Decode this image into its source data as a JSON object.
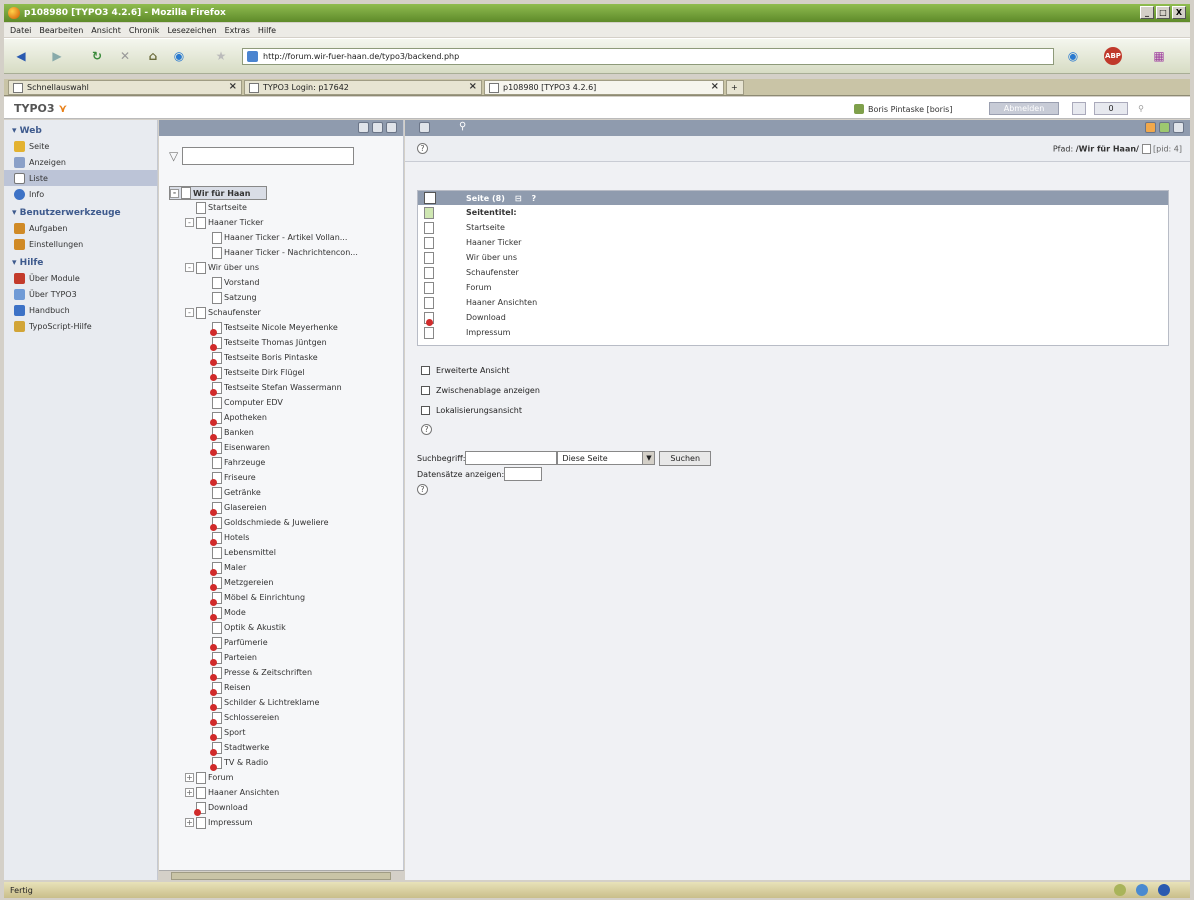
{
  "window": {
    "title": "p108980 [TYPO3 4.2.6] - Mozilla Firefox",
    "buttons": [
      "_",
      "□",
      "X"
    ]
  },
  "menubar": [
    "Datei",
    "Bearbeiten",
    "Ansicht",
    "Chronik",
    "Lesezeichen",
    "Extras",
    "Hilfe"
  ],
  "urlbar": {
    "url": "http://forum.wir-fuer-haan.de/typo3/backend.php"
  },
  "tabs": [
    {
      "label": "Schnellauswahl"
    },
    {
      "label": "TYPO3 Login: p17642"
    },
    {
      "label": "p108980 [TYPO3 4.2.6]"
    }
  ],
  "t3": {
    "logo": "TYPO3",
    "user": "Boris Pintaske [boris]",
    "logout": "Abmelden",
    "counter": "0"
  },
  "modules": {
    "groups": [
      {
        "label": "Web",
        "items": [
          "Seite",
          "Anzeigen",
          "Liste",
          "Info"
        ]
      },
      {
        "label": "Benutzerwerkzeuge",
        "items": [
          "Aufgaben",
          "Einstellungen"
        ]
      },
      {
        "label": "Hilfe",
        "items": [
          "Über Module",
          "Über TYPO3",
          "Handbuch",
          "TypoScript-Hilfe"
        ]
      }
    ],
    "icon_colors": {
      "Seite": "#e3b230",
      "Anzeigen": "#8aa0c8",
      "Liste": "#ffffff",
      "Info": "#3d72c6",
      "Aufgaben": "#d08a26",
      "Einstellungen": "#d08a26",
      "Über Module": "#c33b2b",
      "Über TYPO3": "#6f9ad6",
      "Handbuch": "#3d72c6",
      "TypoScript-Hilfe": "#d2a537"
    }
  },
  "tree": {
    "nodes": [
      {
        "label": "Wir für Haan",
        "depth": 0,
        "pm": "-",
        "selected": true
      },
      {
        "label": "Startseite",
        "depth": 1,
        "pm": ""
      },
      {
        "label": "Haaner Ticker",
        "depth": 1,
        "pm": "-"
      },
      {
        "label": "Haaner Ticker - Artikel Vollan...",
        "depth": 2,
        "pm": ""
      },
      {
        "label": "Haaner Ticker - Nachrichtencon...",
        "depth": 2,
        "pm": ""
      },
      {
        "label": "Wir über uns",
        "depth": 1,
        "pm": "-"
      },
      {
        "label": "Vorstand",
        "depth": 2,
        "pm": ""
      },
      {
        "label": "Satzung",
        "depth": 2,
        "pm": ""
      },
      {
        "label": "Schaufenster",
        "depth": 1,
        "pm": "-"
      },
      {
        "label": "Testseite Nicole Meyerhenke",
        "depth": 2,
        "pm": "",
        "hidden": true
      },
      {
        "label": "Testseite Thomas Jüntgen",
        "depth": 2,
        "pm": "",
        "hidden": true
      },
      {
        "label": "Testseite Boris Pintaske",
        "depth": 2,
        "pm": "",
        "hidden": true
      },
      {
        "label": "Testseite Dirk Flügel",
        "depth": 2,
        "pm": "",
        "hidden": true
      },
      {
        "label": "Testseite Stefan Wassermann",
        "depth": 2,
        "pm": "",
        "hidden": true
      },
      {
        "label": "Computer EDV",
        "depth": 2,
        "pm": ""
      },
      {
        "label": "Apotheken",
        "depth": 2,
        "pm": "",
        "hidden": true
      },
      {
        "label": "Banken",
        "depth": 2,
        "pm": "",
        "hidden": true
      },
      {
        "label": "Eisenwaren",
        "depth": 2,
        "pm": "",
        "hidden": true
      },
      {
        "label": "Fahrzeuge",
        "depth": 2,
        "pm": ""
      },
      {
        "label": "Friseure",
        "depth": 2,
        "pm": "",
        "hidden": true
      },
      {
        "label": "Getränke",
        "depth": 2,
        "pm": ""
      },
      {
        "label": "Glasereien",
        "depth": 2,
        "pm": "",
        "hidden": true
      },
      {
        "label": "Goldschmiede & Juweliere",
        "depth": 2,
        "pm": "",
        "hidden": true
      },
      {
        "label": "Hotels",
        "depth": 2,
        "pm": "",
        "hidden": true
      },
      {
        "label": "Lebensmittel",
        "depth": 2,
        "pm": ""
      },
      {
        "label": "Maler",
        "depth": 2,
        "pm": "",
        "hidden": true
      },
      {
        "label": "Metzgereien",
        "depth": 2,
        "pm": "",
        "hidden": true
      },
      {
        "label": "Möbel & Einrichtung",
        "depth": 2,
        "pm": "",
        "hidden": true
      },
      {
        "label": "Mode",
        "depth": 2,
        "pm": "",
        "hidden": true
      },
      {
        "label": "Optik & Akustik",
        "depth": 2,
        "pm": ""
      },
      {
        "label": "Parfümerie",
        "depth": 2,
        "pm": "",
        "hidden": true
      },
      {
        "label": "Parteien",
        "depth": 2,
        "pm": "",
        "hidden": true
      },
      {
        "label": "Presse & Zeitschriften",
        "depth": 2,
        "pm": "",
        "hidden": true
      },
      {
        "label": "Reisen",
        "depth": 2,
        "pm": "",
        "hidden": true
      },
      {
        "label": "Schilder & Lichtreklame",
        "depth": 2,
        "pm": "",
        "hidden": true
      },
      {
        "label": "Schlossereien",
        "depth": 2,
        "pm": "",
        "hidden": true
      },
      {
        "label": "Sport",
        "depth": 2,
        "pm": "",
        "hidden": true
      },
      {
        "label": "Stadtwerke",
        "depth": 2,
        "pm": "",
        "hidden": true
      },
      {
        "label": "TV & Radio",
        "depth": 2,
        "pm": "",
        "hidden": true
      },
      {
        "label": "Forum",
        "depth": 1,
        "pm": "+"
      },
      {
        "label": "Haaner Ansichten",
        "depth": 1,
        "pm": "+"
      },
      {
        "label": "Download",
        "depth": 1,
        "pm": "",
        "hidden": true
      },
      {
        "label": "Impressum",
        "depth": 1,
        "pm": "+"
      }
    ]
  },
  "content": {
    "path_label": "Pfad:",
    "path_value": "/Wir für Haan/",
    "uid_label": "[pid: 4]",
    "list": {
      "header": "Seite (8)",
      "title_label": "Seitentitel:",
      "rows": [
        {
          "label": "Startseite"
        },
        {
          "label": "Haaner Ticker"
        },
        {
          "label": "Wir über uns"
        },
        {
          "label": "Schaufenster"
        },
        {
          "label": "Forum"
        },
        {
          "label": "Haaner Ansichten"
        },
        {
          "label": "Download",
          "hidden": true
        },
        {
          "label": "Impressum"
        }
      ]
    },
    "checkboxes": [
      "Erweiterte Ansicht",
      "Zwischenablage anzeigen",
      "Lokalisierungsansicht"
    ],
    "search": {
      "label": "Suchbegriff:",
      "scope": "Diese Seite",
      "button": "Suchen",
      "records_label": "Datensätze anzeigen:"
    }
  },
  "status": {
    "text": "Fertig"
  }
}
